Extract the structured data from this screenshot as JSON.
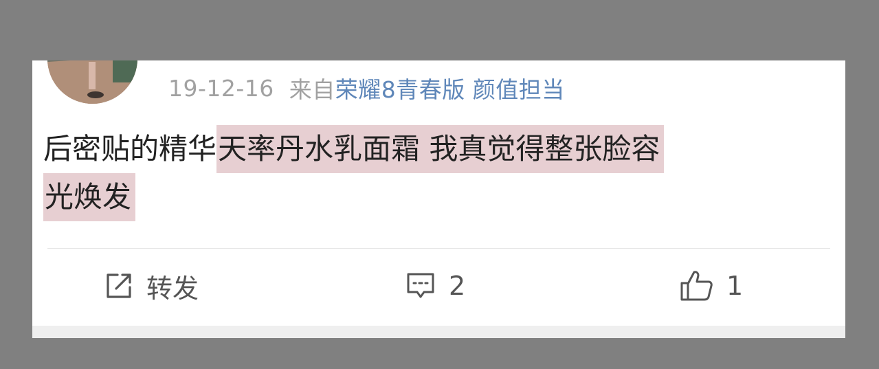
{
  "post": {
    "date": "19-12-16",
    "from_label": "来自",
    "device": "荣耀8青春版 颜值担当",
    "text_plain": "后密贴的精华 ",
    "text_highlight_line1": "天率丹水乳面霜 我真觉得整张脸容",
    "text_highlight_line2": "光焕发"
  },
  "actions": {
    "repost": {
      "label": "转发",
      "icon": "repost-icon"
    },
    "comment": {
      "count": "2",
      "icon": "comment-icon"
    },
    "like": {
      "count": "1",
      "icon": "thumbs-up-icon"
    }
  },
  "colors": {
    "background": "#808080",
    "card": "#ffffff",
    "meta_gray": "#a1a1a1",
    "device_link": "#5f87b9",
    "highlight": "#e7cfd2",
    "text": "#222222",
    "action_text": "#555555"
  }
}
